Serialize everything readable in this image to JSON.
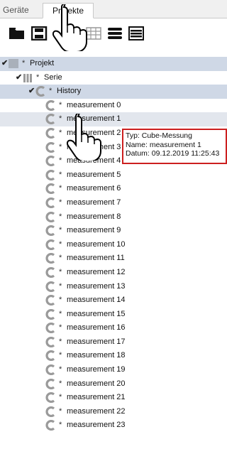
{
  "tabs": [
    {
      "label": "Geräte",
      "active": false
    },
    {
      "label": "Projekte",
      "active": true
    }
  ],
  "toolbar": {
    "icons": [
      "folder-open-icon",
      "save-icon",
      "copy-icon",
      "grid-icon",
      "database-icon",
      "list-icon"
    ]
  },
  "tree": [
    {
      "label": "Projekt",
      "level": 0,
      "icon": "project-icon",
      "expanded": true,
      "selected": true
    },
    {
      "label": "Serie",
      "level": 1,
      "icon": "series-icon",
      "expanded": true
    },
    {
      "label": "History",
      "level": 2,
      "icon": "cube-icon",
      "expanded": true,
      "selected": true
    },
    {
      "label": "measurement 0",
      "level": 3,
      "icon": "cube-icon"
    },
    {
      "label": "measurement 1",
      "level": 3,
      "icon": "cube-icon",
      "highlighted": true
    },
    {
      "label": "measurement 2",
      "level": 3,
      "icon": "cube-icon"
    },
    {
      "label": "measurement 3",
      "level": 3,
      "icon": "cube-icon"
    },
    {
      "label": "measurement 4",
      "level": 3,
      "icon": "cube-icon"
    },
    {
      "label": "measurement 5",
      "level": 3,
      "icon": "cube-icon"
    },
    {
      "label": "measurement 6",
      "level": 3,
      "icon": "cube-icon"
    },
    {
      "label": "measurement 7",
      "level": 3,
      "icon": "cube-icon"
    },
    {
      "label": "measurement 8",
      "level": 3,
      "icon": "cube-icon"
    },
    {
      "label": "measurement 9",
      "level": 3,
      "icon": "cube-icon"
    },
    {
      "label": "measurement 10",
      "level": 3,
      "icon": "cube-icon"
    },
    {
      "label": "measurement 11",
      "level": 3,
      "icon": "cube-icon"
    },
    {
      "label": "measurement 12",
      "level": 3,
      "icon": "cube-icon"
    },
    {
      "label": "measurement 13",
      "level": 3,
      "icon": "cube-icon"
    },
    {
      "label": "measurement 14",
      "level": 3,
      "icon": "cube-icon"
    },
    {
      "label": "measurement 15",
      "level": 3,
      "icon": "cube-icon"
    },
    {
      "label": "measurement 16",
      "level": 3,
      "icon": "cube-icon"
    },
    {
      "label": "measurement 17",
      "level": 3,
      "icon": "cube-icon"
    },
    {
      "label": "measurement 18",
      "level": 3,
      "icon": "cube-icon"
    },
    {
      "label": "measurement 19",
      "level": 3,
      "icon": "cube-icon"
    },
    {
      "label": "measurement 20",
      "level": 3,
      "icon": "cube-icon"
    },
    {
      "label": "measurement 21",
      "level": 3,
      "icon": "cube-icon"
    },
    {
      "label": "measurement 22",
      "level": 3,
      "icon": "cube-icon"
    },
    {
      "label": "measurement 23",
      "level": 3,
      "icon": "cube-icon"
    }
  ],
  "tree_marker": "*",
  "tooltip": {
    "lines": [
      "Typ: Cube-Messung",
      "Name: measurement 1",
      "Datum: 09.12.2019 11:25:43"
    ],
    "border_color": "#cc1f1f"
  },
  "colors": {
    "selection": "#cfd8e6",
    "highlight": "#e2e6ed",
    "cube_icon": "#9a9a9a"
  }
}
